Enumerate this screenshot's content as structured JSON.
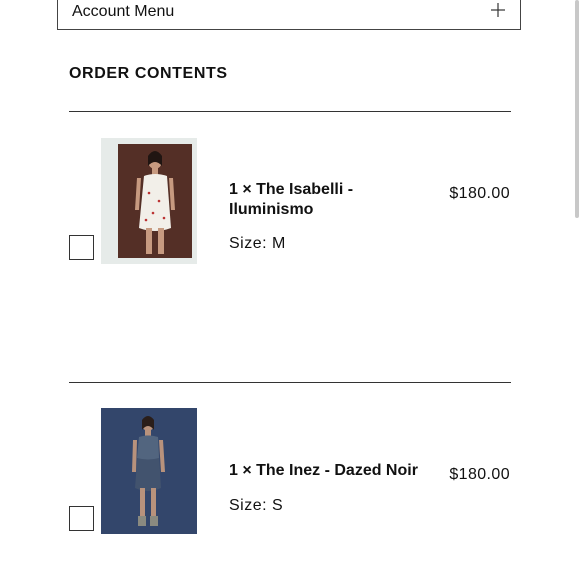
{
  "account_menu": {
    "label": "Account Menu",
    "toggle_icon": "plus-icon"
  },
  "order_contents": {
    "title": "ORDER CONTENTS",
    "items": [
      {
        "name": "1 × The Isabelli - Iluminismo",
        "size": "Size: M",
        "price": "$180.00",
        "image": "product-photo-white-floral-dress"
      },
      {
        "name": "1 × The Inez - Dazed Noir",
        "size": "Size: S",
        "price": "$180.00",
        "image": "product-photo-denim-mini-dress"
      }
    ]
  },
  "colors": {
    "text": "#111111",
    "border": "#333333",
    "background": "#ffffff"
  }
}
